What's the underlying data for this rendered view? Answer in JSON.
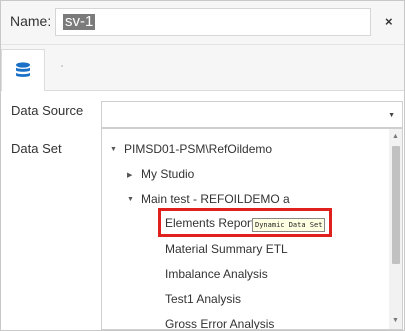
{
  "header": {
    "name_label": "Name:",
    "name_value": "sv-1",
    "close_label": "×"
  },
  "tabs": [
    {
      "icon": "database-icon",
      "active": true
    }
  ],
  "form": {
    "data_source_label": "Data Source",
    "data_set_label": "Data Set",
    "data_source_value": ""
  },
  "tree": {
    "root": "PIMSD01-PSM\\RefOildemo",
    "my_studio": "My Studio",
    "main_test": "Main test - REFOILDEMO a",
    "items": [
      "Elements Report",
      "Material Summary ETL",
      "Imbalance Analysis",
      "Test1 Analysis",
      "Gross Error Analysis"
    ]
  },
  "tooltip": "Dynamic Data Set",
  "colors": {
    "highlight": "#e0201d",
    "icon": "#1a6fc6",
    "tooltip_bg": "#ffffe1"
  }
}
